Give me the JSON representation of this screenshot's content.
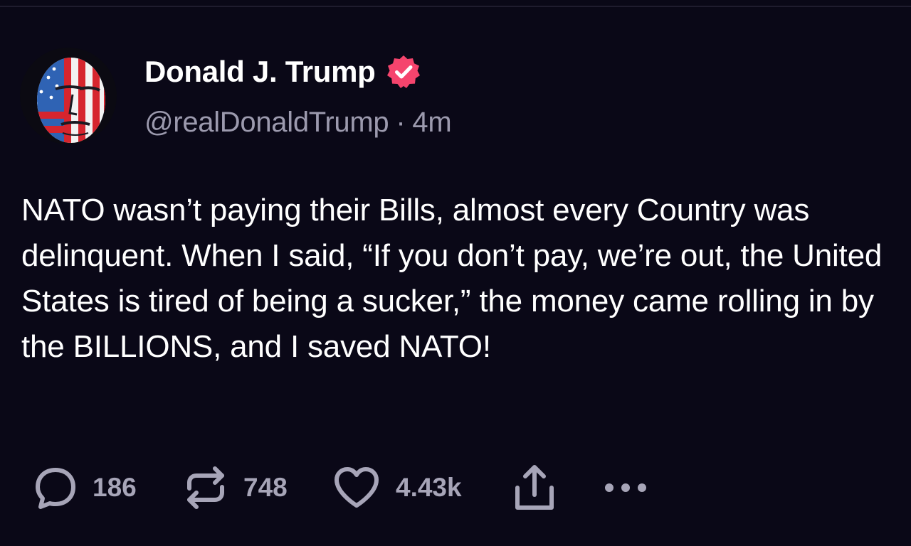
{
  "author": {
    "display_name": "Donald J. Trump",
    "handle": "@realDonaldTrump",
    "separator": "·",
    "time_ago": "4m",
    "verified": true,
    "verified_color": "#f5446d"
  },
  "post": {
    "text": "NATO wasn’t paying their Bills, almost every Country was delinquent. When I said, “If you don’t pay, we’re out, the United States is tired of being a sucker,” the money came rolling in by the BILLIONS, and I saved NATO!"
  },
  "actions": {
    "replies": {
      "icon": "reply-icon",
      "count": "186"
    },
    "reposts": {
      "icon": "repost-icon",
      "count": "748"
    },
    "likes": {
      "icon": "heart-icon",
      "count": "4.43k"
    },
    "share": {
      "icon": "share-icon"
    },
    "more": {
      "icon": "more-icon"
    }
  },
  "colors": {
    "background": "#0a0817",
    "text": "#ffffff",
    "muted": "#9c9aae",
    "icon": "#a7a5b8"
  }
}
